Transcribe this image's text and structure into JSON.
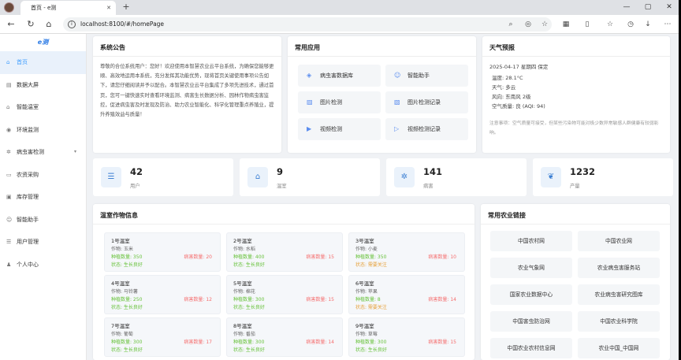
{
  "browser": {
    "tab_title": "首页 - e测",
    "url": "localhost:8100/#/homePage"
  },
  "sidebar": {
    "logo": "e测",
    "items": [
      {
        "label": "首页",
        "icon": "home-icon",
        "active": true
      },
      {
        "label": "数据大屏",
        "icon": "chart-icon"
      },
      {
        "label": "智能温室",
        "icon": "greenhouse-icon"
      },
      {
        "label": "环境监测",
        "icon": "monitor-icon"
      },
      {
        "label": "病虫害检测",
        "icon": "bug-icon",
        "has_children": true
      },
      {
        "label": "农资采购",
        "icon": "cart-icon"
      },
      {
        "label": "库存管理",
        "icon": "box-icon"
      },
      {
        "label": "智能助手",
        "icon": "robot-icon"
      },
      {
        "label": "用户管理",
        "icon": "users-icon"
      },
      {
        "label": "个人中心",
        "icon": "person-icon"
      }
    ]
  },
  "notice": {
    "title": "系统公告",
    "text": "尊敬的合位系统用户：您好！欢迎使用本智慧农业云平台系统，为确保您能够更顺、高效地运用本系统，充分发挥其功能优势，现将首页关键使用事项公告如下，请您仔细阅读并予以配合。本智慧农业云平台集成了多项先进技术，通过首页，您可一键快速实时查看环境监测、病害生长数据分析、园林作物病虫害监控，促进病虫害及时发现及防治、助力农业智能化、科学化管理重点养殖业，提升养殖效益与质量！"
  },
  "apps": {
    "title": "常用应用",
    "items": [
      {
        "label": "病虫害数据库",
        "icon": "database-icon"
      },
      {
        "label": "智能助手",
        "icon": "robot-icon"
      },
      {
        "label": "图片检测",
        "icon": "image-icon"
      },
      {
        "label": "图片检测记录",
        "icon": "image-record-icon"
      },
      {
        "label": "视频检测",
        "icon": "video-icon"
      },
      {
        "label": "视频检测记录",
        "icon": "video-record-icon"
      }
    ]
  },
  "weather": {
    "title": "天气预报",
    "date_line": "2025-04-17  星期四  保定",
    "lines": [
      "温度: 28.1°C",
      "天气: 多云",
      "风向: 东南风 2级",
      "空气质量: 良 (AQI: 94)"
    ],
    "note": "注意事项：空气质量可接受，但某些污染物可能对极少数异常敏感人群健康有较弱影响。"
  },
  "stats": [
    {
      "value": "42",
      "label": "用户",
      "icon": "users-icon"
    },
    {
      "value": "9",
      "label": "温室",
      "icon": "greenhouse-icon"
    },
    {
      "value": "141",
      "label": "病害",
      "icon": "bug-icon"
    },
    {
      "value": "1232",
      "label": "产量",
      "icon": "leaf-icon"
    }
  ],
  "greenhouses": {
    "title": "温室作物信息",
    "items": [
      {
        "name": "1号温室",
        "crop": "作物: 玉米",
        "planted": "种植数量: 350",
        "disease": "病害数量: 20",
        "status": "状态: 生长良好",
        "warn": false
      },
      {
        "name": "2号温室",
        "crop": "作物: 水稻",
        "planted": "种植数量: 400",
        "disease": "病害数量: 15",
        "status": "状态: 生长良好",
        "warn": false
      },
      {
        "name": "3号温室",
        "crop": "作物: 小麦",
        "planted": "种植数量: 350",
        "disease": "病害数量: 10",
        "status": "状态: 需要关注",
        "warn": true
      },
      {
        "name": "4号温室",
        "crop": "作物: 马铃薯",
        "planted": "种植数量: 250",
        "disease": "病害数量: 12",
        "status": "状态: 生长良好",
        "warn": false
      },
      {
        "name": "5号温室",
        "crop": "作物: 棉花",
        "planted": "种植数量: 300",
        "disease": "病害数量: 15",
        "status": "状态: 生长良好",
        "warn": false
      },
      {
        "name": "6号温室",
        "crop": "作物: 苹果",
        "planted": "种植数量: 8",
        "disease": "病害数量: 14",
        "status": "状态: 需要关注",
        "warn": true
      },
      {
        "name": "7号温室",
        "crop": "作物: 葡萄",
        "planted": "种植数量: 300",
        "disease": "病害数量: 17",
        "status": "状态: 生长良好",
        "warn": false
      },
      {
        "name": "8号温室",
        "crop": "作物: 番茄",
        "planted": "种植数量: 300",
        "disease": "病害数量: 14",
        "status": "状态: 生长良好",
        "warn": false
      },
      {
        "name": "9号温室",
        "crop": "作物: 草莓",
        "planted": "种植数量: 300",
        "disease": "病害数量: 15",
        "status": "状态: 生长良好",
        "warn": false
      }
    ]
  },
  "links": {
    "title": "常用农业链接",
    "items": [
      "中国农村网",
      "中国农业网",
      "农业气象网",
      "农业病虫害服务站",
      "国家农业数据中心",
      "农业病虫害研究图库",
      "中国害虫防治网",
      "中国农业科学院",
      "中国农业农村信息网",
      "农业中国_中国网"
    ]
  }
}
